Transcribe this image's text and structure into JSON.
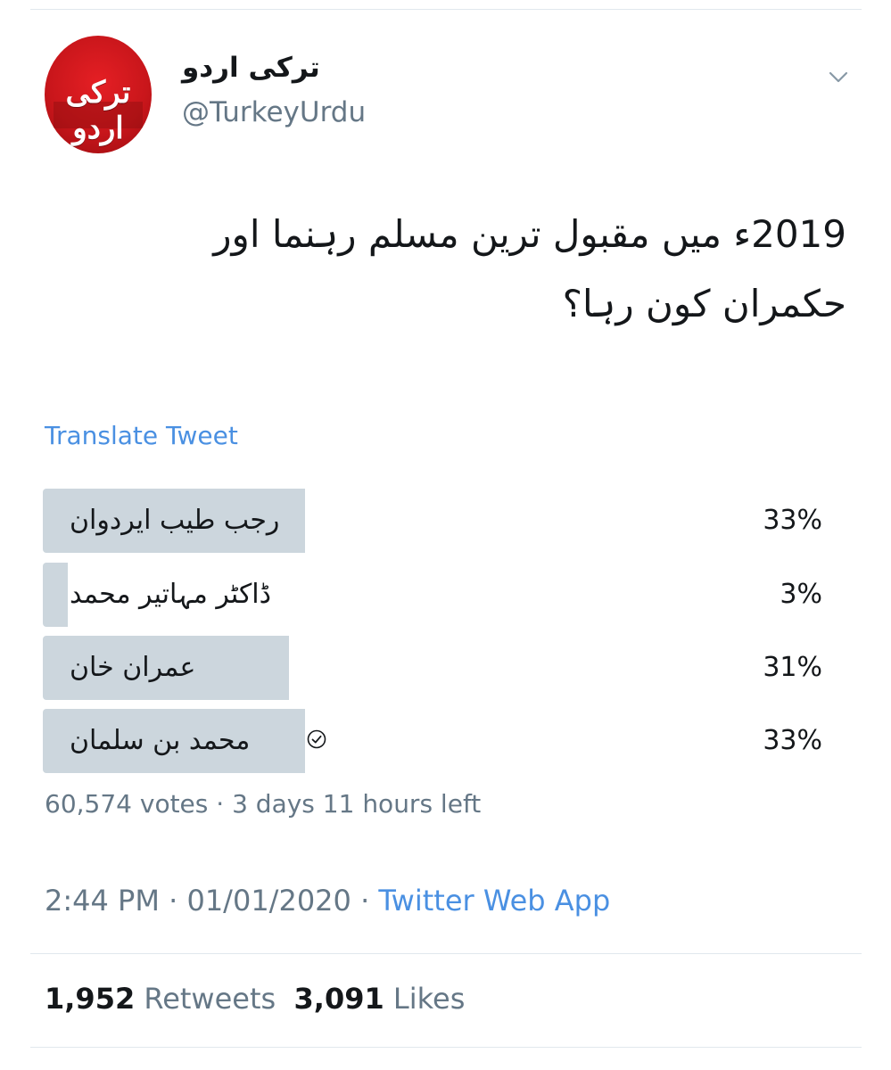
{
  "author": {
    "display_name": "ترکی اردو",
    "handle": "@TurkeyUrdu",
    "avatar_text": "ترکی اردو",
    "brand_color": "#d7191f"
  },
  "icons": {
    "menu": "chevron-down-icon",
    "winner": "check-circle-icon"
  },
  "tweet": {
    "text": "2019ء میں مقبول ترین مسلم رہنما اور حکمران کون رہا؟",
    "translate_label": "Translate Tweet"
  },
  "poll": {
    "options": [
      {
        "label": "رجب طیب ایردوان",
        "percent": "33%",
        "fraction": 0.33,
        "selected": false
      },
      {
        "label": "ڈاکٹر مہاتیر محمد",
        "percent": "3%",
        "fraction": 0.03,
        "selected": false
      },
      {
        "label": "عمران خان",
        "percent": "31%",
        "fraction": 0.31,
        "selected": false
      },
      {
        "label": "محمد بن سلمان",
        "percent": "33%",
        "fraction": 0.33,
        "selected": true
      }
    ],
    "votes": "60,574 votes",
    "separator": " · ",
    "time_left": "3 days 11 hours left"
  },
  "meta": {
    "time": "2:44 PM",
    "date": "01/01/2020",
    "separator": " · ",
    "source": "Twitter Web App"
  },
  "stats": {
    "retweets_count": "1,952",
    "retweets_label": "Retweets",
    "likes_count": "3,091",
    "likes_label": "Likes"
  },
  "colors": {
    "link": "#4a90e2",
    "muted": "#657786",
    "text": "#14171a",
    "poll_bar": "#ccd6dd"
  }
}
